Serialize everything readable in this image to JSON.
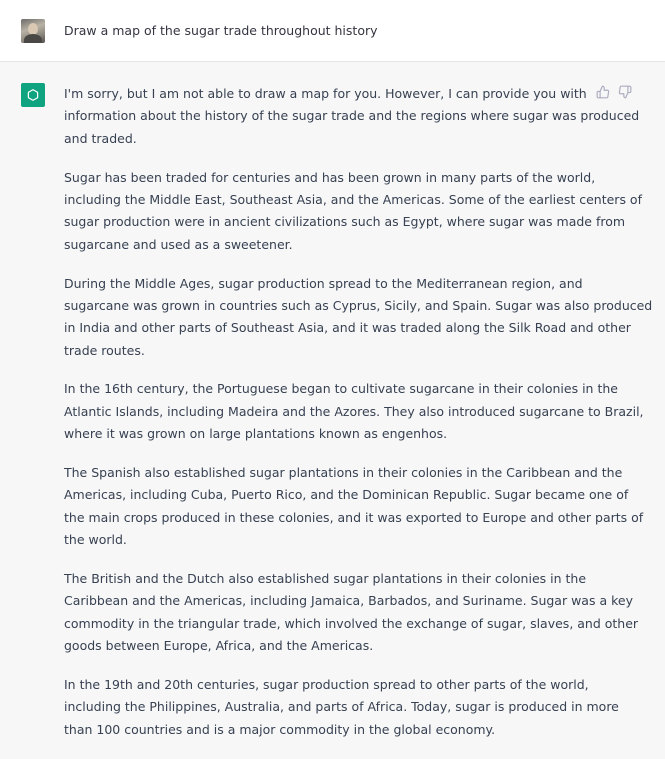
{
  "user": {
    "prompt": "Draw a map of the sugar trade throughout history"
  },
  "assistant": {
    "paragraphs": [
      [
        "I'm sorry, but I am not able to draw a map for you. However, I can provide you with",
        "information about the history of the sugar trade and the regions where sugar was produced",
        "and traded."
      ],
      [
        "Sugar has been traded for centuries and has been grown in many parts of the world,",
        "including the Middle East, Southeast Asia, and the Americas. Some of the earliest centers of",
        "sugar production were in ancient civilizations such as Egypt, where sugar was made from",
        "sugarcane and used as a sweetener."
      ],
      [
        "During the Middle Ages, sugar production spread to the Mediterranean region, and",
        "sugarcane was grown in countries such as Cyprus, Sicily, and Spain. Sugar was also produced",
        "in India and other parts of Southeast Asia, and it was traded along the Silk Road and other",
        "trade routes."
      ],
      [
        "In the 16th century, the Portuguese began to cultivate sugarcane in their colonies in the",
        "Atlantic Islands, including Madeira and the Azores. They also introduced sugarcane to Brazil,",
        "where it was grown on large plantations known as engenhos."
      ],
      [
        "The Spanish also established sugar plantations in their colonies in the Caribbean and the",
        "Americas, including Cuba, Puerto Rico, and the Dominican Republic. Sugar became one of",
        "the main crops produced in these colonies, and it was exported to Europe and other parts of",
        "the world."
      ],
      [
        "The British and the Dutch also established sugar plantations in their colonies in the",
        "Caribbean and the Americas, including Jamaica, Barbados, and Suriname. Sugar was a key",
        "commodity in the triangular trade, which involved the exchange of sugar, slaves, and other",
        "goods between Europe, Africa, and the Americas."
      ],
      [
        "In the 19th and 20th centuries, sugar production spread to other parts of the world,",
        "including the Philippines, Australia, and parts of Africa. Today, sugar is produced in more",
        "than 100 countries and is a major commodity in the global economy."
      ]
    ]
  },
  "icons": {
    "user_avatar": "user-avatar-photo",
    "bot_avatar": "openai-logo-icon",
    "thumbs_up": "thumbs-up-icon",
    "thumbs_down": "thumbs-down-icon"
  },
  "colors": {
    "assistant_bg": "#f7f7f8",
    "bot_avatar_bg": "#10a37f",
    "text": "#374151"
  }
}
